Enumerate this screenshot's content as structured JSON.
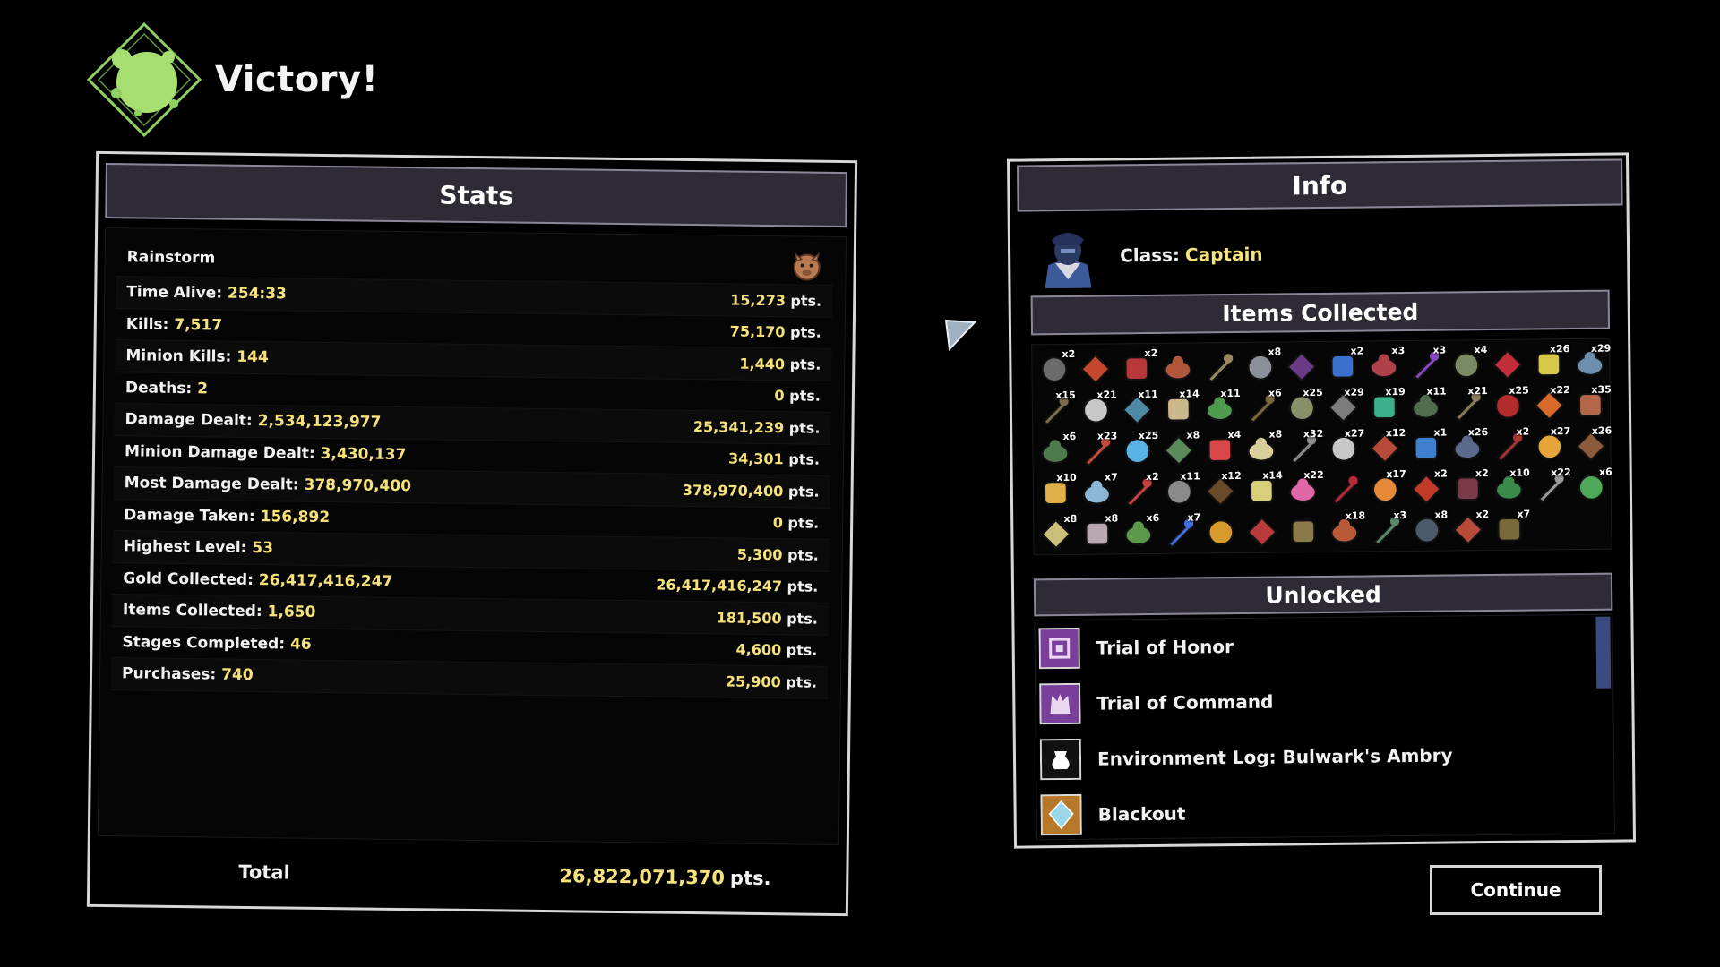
{
  "header": {
    "title": "Victory!",
    "emblem_icon": "victory-emblem-icon"
  },
  "stats": {
    "title": "Stats",
    "artifact": "Rainstorm",
    "artifact_icon": "boar-artifact-icon",
    "rows": [
      {
        "label": "Time Alive:",
        "value": "254:33",
        "pts": "15,273"
      },
      {
        "label": "Kills:",
        "value": "7,517",
        "pts": "75,170"
      },
      {
        "label": "Minion Kills:",
        "value": "144",
        "pts": "1,440"
      },
      {
        "label": "Deaths:",
        "value": "2",
        "pts": "0"
      },
      {
        "label": "Damage Dealt:",
        "value": "2,534,123,977",
        "pts": "25,341,239"
      },
      {
        "label": "Minion Damage Dealt:",
        "value": "3,430,137",
        "pts": "34,301"
      },
      {
        "label": "Most Damage Dealt:",
        "value": "378,970,400",
        "pts": "378,970,400"
      },
      {
        "label": "Damage Taken:",
        "value": "156,892",
        "pts": "0"
      },
      {
        "label": "Highest Level:",
        "value": "53",
        "pts": "5,300"
      },
      {
        "label": "Gold Collected:",
        "value": "26,417,416,247",
        "pts": "26,417,416,247"
      },
      {
        "label": "Items Collected:",
        "value": "1,650",
        "pts": "181,500"
      },
      {
        "label": "Stages Completed:",
        "value": "46",
        "pts": "4,600"
      },
      {
        "label": "Purchases:",
        "value": "740",
        "pts": "25,900"
      }
    ],
    "pts_unit": "pts.",
    "total_label": "Total",
    "total_value": "26,822,071,370",
    "total_unit": "pts."
  },
  "nav": {
    "arrow_icon": "page-arrow-icon"
  },
  "info": {
    "title": "Info",
    "class_label": "Class:",
    "class_value": "Captain",
    "class_icon": "captain-portrait-icon",
    "items_title": "Items Collected",
    "items": [
      {
        "icon": "glove-item-icon",
        "count": "x2",
        "color": "#6b6b6b"
      },
      {
        "icon": "mushroom-item-icon",
        "count": "",
        "color": "#c4472e"
      },
      {
        "icon": "boots-item-icon",
        "count": "x2",
        "color": "#b8383a"
      },
      {
        "icon": "claw-item-icon",
        "count": "",
        "color": "#b0563a"
      },
      {
        "icon": "skull-item-icon",
        "count": "",
        "color": "#9a8660"
      },
      {
        "icon": "key-item-icon",
        "count": "x8",
        "color": "#8a8f99"
      },
      {
        "icon": "orb-item-icon",
        "count": "",
        "color": "#6a3a86"
      },
      {
        "icon": "snowflake-item-icon",
        "count": "x2",
        "color": "#3b6fd0"
      },
      {
        "icon": "plant-item-icon",
        "count": "x3",
        "color": "#b0404a"
      },
      {
        "icon": "brain-item-icon",
        "count": "x3",
        "color": "#8a47c4"
      },
      {
        "icon": "helmet-item-icon",
        "count": "x4",
        "color": "#7a8a62"
      },
      {
        "icon": "ring-item-icon",
        "count": "",
        "color": "#c22d3a"
      },
      {
        "icon": "syringe-item-icon",
        "count": "x26",
        "color": "#d8c84a"
      },
      {
        "icon": "teapot-item-icon",
        "count": "x29",
        "color": "#6d8fb0"
      },
      {
        "icon": "bag-item-icon",
        "count": "x15",
        "color": "#7d6a48"
      },
      {
        "icon": "knife-item-icon",
        "count": "x21",
        "color": "#c7c7c7"
      },
      {
        "icon": "soda-item-icon",
        "count": "x11",
        "color": "#4e8aa6"
      },
      {
        "icon": "bones-item-icon",
        "count": "x14",
        "color": "#cbb88a"
      },
      {
        "icon": "spiral-item-icon",
        "count": "x11",
        "color": "#4e9a4e"
      },
      {
        "icon": "belt-item-icon",
        "count": "x6",
        "color": "#7a6a3a"
      },
      {
        "icon": "battery-item-icon",
        "count": "x25",
        "color": "#88906a"
      },
      {
        "icon": "claws-item-icon",
        "count": "x29",
        "color": "#7c7c7c"
      },
      {
        "icon": "bird-item-icon",
        "count": "x19",
        "color": "#3bb08a"
      },
      {
        "icon": "scroll-item-icon",
        "count": "x11",
        "color": "#4e6e4e"
      },
      {
        "icon": "bandage-item-icon",
        "count": "x21",
        "color": "#8d7a5a"
      },
      {
        "icon": "book-item-icon",
        "count": "x25",
        "color": "#b42b2b"
      },
      {
        "icon": "rocket-item-icon",
        "count": "x22",
        "color": "#d76a2a"
      },
      {
        "icon": "spear-item-icon",
        "count": "x35",
        "color": "#b3674a"
      },
      {
        "icon": "leech-item-icon",
        "count": "x6",
        "color": "#4e7a4e"
      },
      {
        "icon": "steak-item-icon",
        "count": "x23",
        "color": "#c2493a"
      },
      {
        "icon": "crystal-item-icon",
        "count": "x25",
        "color": "#5ab3e6"
      },
      {
        "icon": "tentacle-item-icon",
        "count": "x8",
        "color": "#5b8a5b"
      },
      {
        "icon": "chain-item-icon",
        "count": "x4",
        "color": "#d8474a"
      },
      {
        "icon": "bone-item-icon",
        "count": "x8",
        "color": "#d8cf9a"
      },
      {
        "icon": "wire-item-icon",
        "count": "x32",
        "color": "#8b8b8b"
      },
      {
        "icon": "medkit-item-icon",
        "count": "x27",
        "color": "#c7c7c7"
      },
      {
        "icon": "hammer-item-icon",
        "count": "x12",
        "color": "#b84a3a"
      },
      {
        "icon": "feather-item-icon",
        "count": "x1",
        "color": "#3f7fd0"
      },
      {
        "icon": "fish-item-icon",
        "count": "x26",
        "color": "#5a6a8a"
      },
      {
        "icon": "axe-item-icon",
        "count": "x2",
        "color": "#a8342f"
      },
      {
        "icon": "flame-item-icon",
        "count": "x27",
        "color": "#e6a53a"
      },
      {
        "icon": "beast-item-icon",
        "count": "x26",
        "color": "#8d5a3a"
      },
      {
        "icon": "coin-item-icon",
        "count": "x10",
        "color": "#e0b04a"
      },
      {
        "icon": "halo-item-icon",
        "count": "x7",
        "color": "#8cb8d8"
      },
      {
        "icon": "chainlink-item-icon",
        "count": "x2",
        "color": "#c84040"
      },
      {
        "icon": "canister-item-icon",
        "count": "x11",
        "color": "#8a8a8a"
      },
      {
        "icon": "hand-item-icon",
        "count": "x12",
        "color": "#6a4a2a"
      },
      {
        "icon": "wrench-item-icon",
        "count": "x14",
        "color": "#d8cf7a"
      },
      {
        "icon": "card-item-icon",
        "count": "x22",
        "color": "#e066a8"
      },
      {
        "icon": "heart-item-icon",
        "count": "",
        "color": "#b82a3a"
      },
      {
        "icon": "lens-item-icon",
        "count": "x17",
        "color": "#e68a3a"
      },
      {
        "icon": "pepper-item-icon",
        "count": "x2",
        "color": "#c23a2a"
      },
      {
        "icon": "bomb-item-icon",
        "count": "x2",
        "color": "#7a3a4a"
      },
      {
        "icon": "coil-item-icon",
        "count": "x10",
        "color": "#3a8a4a"
      },
      {
        "icon": "crown-item-icon",
        "count": "x22",
        "color": "#9a9a9a"
      },
      {
        "icon": "flask-item-icon",
        "count": "x6",
        "color": "#4eaa5a"
      },
      {
        "icon": "leaf-item-icon",
        "count": "x8",
        "color": "#cbbf7a"
      },
      {
        "icon": "mask-item-icon",
        "count": "x8",
        "color": "#b8a8b0"
      },
      {
        "icon": "vine-item-icon",
        "count": "x6",
        "color": "#5a9a4a"
      },
      {
        "icon": "flower-item-icon",
        "count": "x7",
        "color": "#3f6fe0"
      },
      {
        "icon": "cube-item-icon",
        "count": "",
        "color": "#d89a2a"
      },
      {
        "icon": "chalice-item-icon",
        "count": "",
        "color": "#b83a3a"
      },
      {
        "icon": "shell-item-icon",
        "count": "",
        "color": "#8a7a4a"
      },
      {
        "icon": "figure-item-icon",
        "count": "x18",
        "color": "#b85a3a"
      },
      {
        "icon": "horn-item-icon",
        "count": "x3",
        "color": "#5a8a6a"
      },
      {
        "icon": "tome-item-icon",
        "count": "x8",
        "color": "#4a5a6a"
      },
      {
        "icon": "gears-item-icon",
        "count": "x2",
        "color": "#b84a3a"
      },
      {
        "icon": "nest-item-icon",
        "count": "x7",
        "color": "#7a6a3a"
      }
    ],
    "unlocked_title": "Unlocked",
    "unlocked": [
      {
        "label": "Trial of Honor",
        "icon": "trial-honor-icon",
        "bg": "#7a3f9a"
      },
      {
        "label": "Trial of Command",
        "icon": "trial-command-icon",
        "bg": "#7a3f9a"
      },
      {
        "label": "Environment Log: Bulwark's Ambry",
        "icon": "environment-log-icon",
        "bg": "#111111"
      },
      {
        "label": "Blackout",
        "icon": "blackout-skin-icon",
        "bg": "#b8782a"
      }
    ]
  },
  "footer": {
    "continue_label": "Continue"
  }
}
